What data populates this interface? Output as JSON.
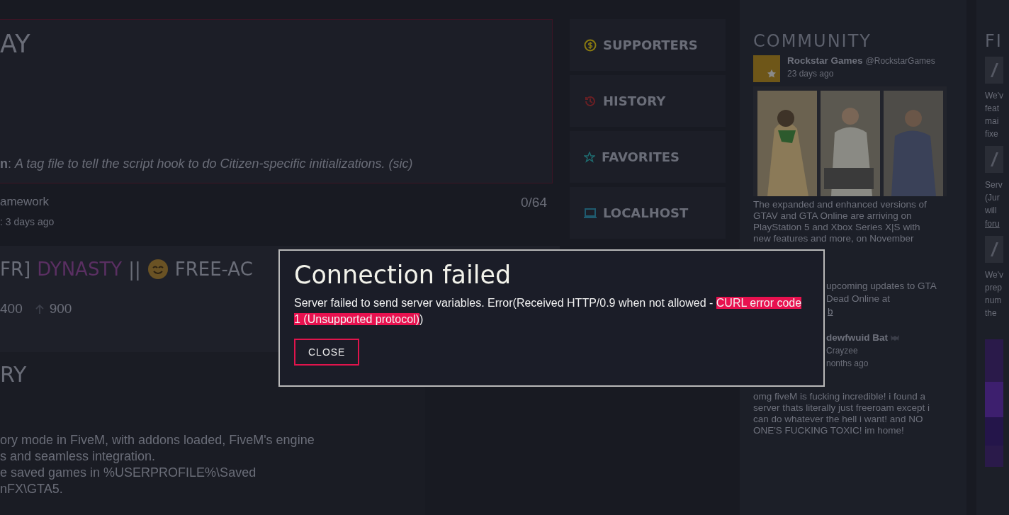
{
  "featured": {
    "title": "AY",
    "description": "**n**: *A tag file to tell the script hook to do Citizen-specific initializations. (sic)*"
  },
  "resource_row": {
    "name": "amework",
    "count": "0/64",
    "updated": ": 3 days ago"
  },
  "server": {
    "prefix": "FR]",
    "name": "DYNASTY",
    "separator": "||",
    "suffix": "FREE-AC",
    "players": "400",
    "upvotes": "900"
  },
  "story": {
    "title": "RY",
    "lines": [
      "ory mode in FiveM, with addons loaded, FiveM's engine",
      "s and seamless integration.",
      "e saved games in %USERPROFILE%\\Saved",
      "nFX\\GTA5."
    ]
  },
  "nav": [
    {
      "kind": "supporters",
      "label": "SUPPORTERS",
      "color": "#8a7a10"
    },
    {
      "kind": "history",
      "label": "HISTORY",
      "color": "#6a1f24"
    },
    {
      "kind": "favorites",
      "label": "FAVORITES",
      "color": "#1f6a6e"
    },
    {
      "kind": "localhost",
      "label": "LOCALHOST",
      "color": "#1f5a6e"
    }
  ],
  "community": {
    "title": "COMMUNITY",
    "posts": [
      {
        "author": "Rockstar Games",
        "handle": "@RockstarGames",
        "time": "23 days ago",
        "has_picture": true,
        "body": "The expanded and enhanced versions of GTAV and GTA Online are arriving on PlayStation 5 and Xbox Series X|S with new features and more, on November",
        "peek_lines": [
          "upcoming updates to GTA",
          "Dead Online at"
        ],
        "peek_link": "b"
      },
      {
        "author": "dewfwuid Bat",
        "handle": "Crayzee",
        "time": "nonths ago",
        "has_picture": false,
        "body": "omg fiveM is fucking incredible! i found a server thats literally just freeroam except i can do whatever the hell i want! and NO ONE'S FUCKING TOXIC! im home!"
      }
    ]
  },
  "side": {
    "title": "FI",
    "blocks": [
      {
        "lines": [
          "We'v",
          "feat",
          "mai",
          "fixe"
        ]
      },
      {
        "lines": [
          "Serv",
          "(Jur",
          "will"
        ],
        "link": "foru"
      },
      {
        "lines": [
          "We'v",
          "prep",
          "num",
          "the"
        ]
      }
    ]
  },
  "dialog": {
    "title": "Connection failed",
    "message_before": "Server failed to send server variables. Error(Received HTTP/0.9 when not allowed - ",
    "message_highlight": "CURL error code 1 (Unsupported protocol)",
    "message_after": ")",
    "button": "CLOSE"
  }
}
